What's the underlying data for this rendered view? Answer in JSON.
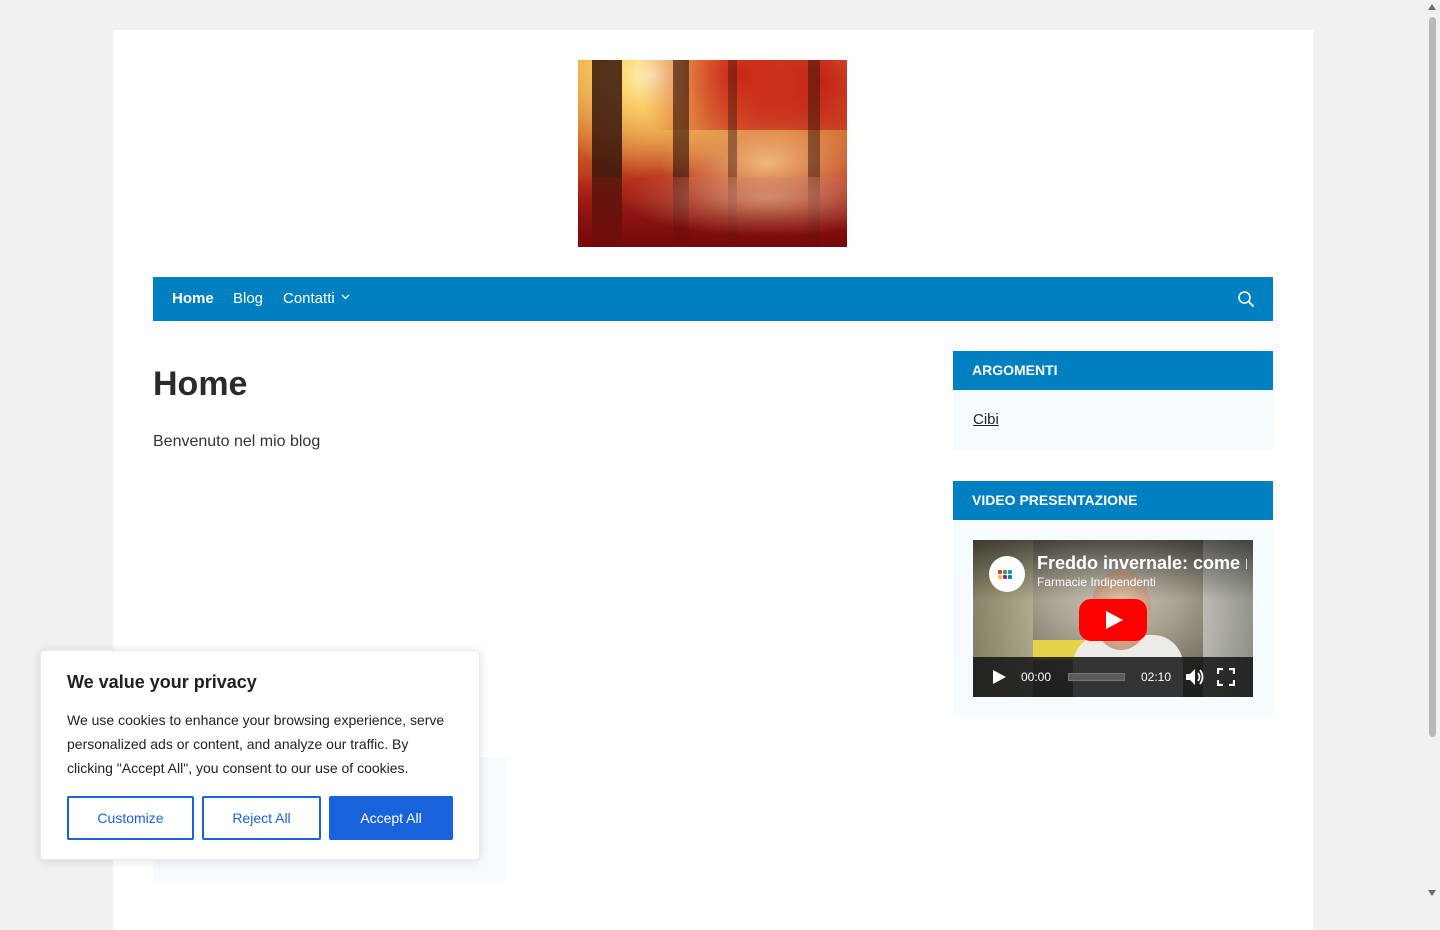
{
  "nav": {
    "items": [
      {
        "label": "Home"
      },
      {
        "label": "Blog"
      },
      {
        "label": "Contatti"
      }
    ],
    "search_icon": "search-icon",
    "color": "#0080c0"
  },
  "main": {
    "title": "Home",
    "intro": "Benvenuto nel mio blog"
  },
  "sidebar": {
    "argomenti": {
      "title": "ARGOMENTI",
      "items": [
        {
          "label": "Cibi"
        }
      ]
    },
    "video": {
      "title": "VIDEO PRESENTAZIONE",
      "video_title": "Freddo invernale: come r",
      "channel": "Farmacie Indipendenti",
      "current_time": "00:00",
      "duration": "02:10"
    }
  },
  "cookie": {
    "title": "We value your privacy",
    "text": "We use cookies to enhance your browsing experience, serve personalized ads or content, and analyze our traffic. By clicking \"Accept All\", you consent to our use of cookies.",
    "customize_label": "Customize",
    "reject_label": "Reject All",
    "accept_label": "Accept All",
    "accent": "#1863dc"
  }
}
